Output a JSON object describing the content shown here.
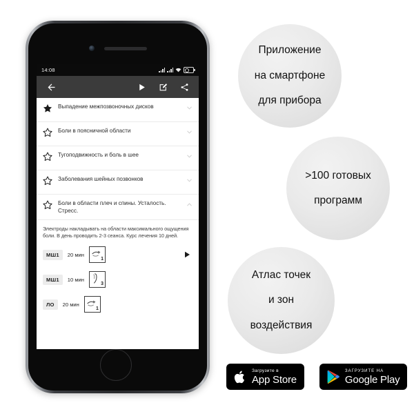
{
  "phone": {
    "status_bar": {
      "time": "14:08",
      "icons": [
        "signal-icon",
        "signal-icon",
        "wifi-icon",
        "battery-icon"
      ]
    },
    "toolbar": {
      "back_icon": "arrow-back-icon",
      "play_icon": "play-icon",
      "edit_icon": "edit-icon",
      "share_icon": "share-icon"
    },
    "list": [
      {
        "label": "Выпадение межпозвоночных дисков",
        "starred": true,
        "expanded": false
      },
      {
        "label": "Боли в поясничной области",
        "starred": false,
        "expanded": false
      },
      {
        "label": "Тугоподвижность и боль в шее",
        "starred": false,
        "expanded": false
      },
      {
        "label": "Заболевания шейных позвонков",
        "starred": false,
        "expanded": false
      },
      {
        "label": "Боли в области плеч и спины. Усталость. Стресс.",
        "starred": false,
        "expanded": true
      }
    ],
    "description": "Электроды накладывать на области максимального ощущения боли. В день проводить 2-3 сеанса. Курс лечения 10 дней.",
    "programs": [
      {
        "code": "МШ1",
        "duration": "20 мин",
        "thumb_number": "1",
        "has_play": true
      },
      {
        "code": "МШ1",
        "duration": "10 мин",
        "thumb_number": "3",
        "has_play": false
      },
      {
        "code": "ЛО",
        "duration": "20 мин",
        "thumb_number": "1",
        "has_play": false
      }
    ]
  },
  "bubbles": [
    {
      "line1": "Приложение",
      "line2": "на смартфоне",
      "line3": "для прибора"
    },
    {
      "line1": ">100 готовых",
      "line2": "программ",
      "line3": ""
    },
    {
      "line1": "Атлас точек",
      "line2": "и зон",
      "line3": "воздействия"
    }
  ],
  "badges": [
    {
      "small": "Загрузите в",
      "big": "App Store",
      "icon": "apple-logo-icon"
    },
    {
      "small": "ЗАГРУЗИТЕ НА",
      "big": "Google Play",
      "icon": "google-play-icon"
    }
  ],
  "colors": {
    "background": "#ffffff",
    "toolbar": "#3b3b3b",
    "status_bar": "#0b0b0b",
    "bubble": "#e8e8e8",
    "badge": "#000000"
  }
}
